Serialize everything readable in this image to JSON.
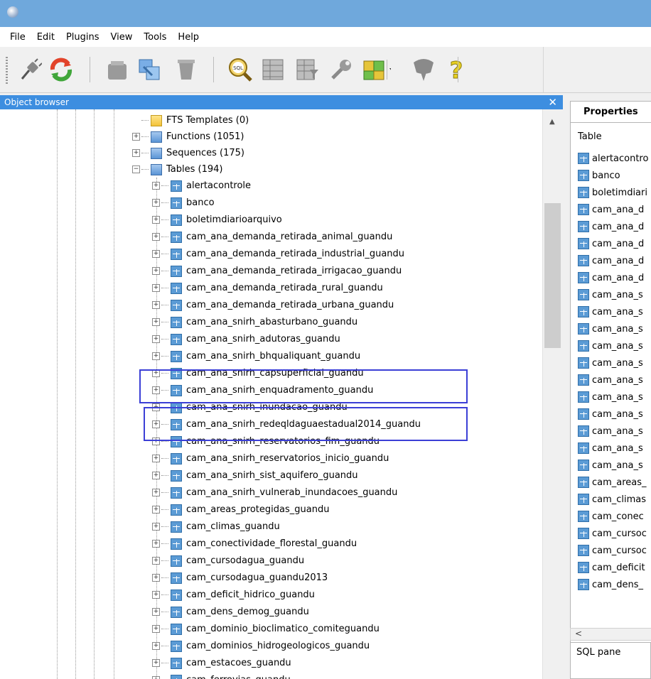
{
  "menu": [
    "File",
    "Edit",
    "Plugins",
    "View",
    "Tools",
    "Help"
  ],
  "toolbar": {
    "icons": [
      "plug-icon",
      "refresh-icon",
      "drop-object-icon",
      "copy-icon",
      "trash-icon",
      "sql-query-icon",
      "view-data-icon",
      "filtered-data-icon",
      "maintenance-wrench-icon",
      "plugins-puzzle-icon",
      "guru-hint-icon",
      "help-icon"
    ],
    "sql_label": "SQL"
  },
  "object_browser": {
    "title": "Object browser",
    "close_glyph": "✕",
    "scroll_up_glyph": "▲",
    "groups": [
      {
        "label": "FTS Templates (0)",
        "icon": "fts-templates-icon",
        "expander": ""
      },
      {
        "label": "Functions (1051)",
        "icon": "functions-icon",
        "expander": "+"
      },
      {
        "label": "Sequences (175)",
        "icon": "sequences-icon",
        "expander": "+"
      },
      {
        "label": "Tables (194)",
        "icon": "tables-folder-icon",
        "expander": "−"
      }
    ],
    "tables": [
      "alertacontrole",
      "banco",
      "boletimdiarioarquivo",
      "cam_ana_demanda_retirada_animal_guandu",
      "cam_ana_demanda_retirada_industrial_guandu",
      "cam_ana_demanda_retirada_irrigacao_guandu",
      "cam_ana_demanda_retirada_rural_guandu",
      "cam_ana_demanda_retirada_urbana_guandu",
      "cam_ana_snirh_abasturbano_guandu",
      "cam_ana_snirh_adutoras_guandu",
      "cam_ana_snirh_bhqualiquant_guandu",
      "cam_ana_snirh_capsuperficial_guandu",
      "cam_ana_snirh_enquadramento_guandu",
      "cam_ana_snirh_inundacao_guandu",
      "cam_ana_snirh_redeqldaguaestadual2014_guandu",
      "cam_ana_snirh_reservatorios_fim_guandu",
      "cam_ana_snirh_reservatorios_inicio_guandu",
      "cam_ana_snirh_sist_aquifero_guandu",
      "cam_ana_snirh_vulnerab_inundacoes_guandu",
      "cam_areas_protegidas_guandu",
      "cam_climas_guandu",
      "cam_conectividade_florestal_guandu",
      "cam_cursodagua_guandu",
      "cam_cursodagua_guandu2013",
      "cam_deficit_hidrico_guandu",
      "cam_dens_demog_guandu",
      "cam_dominio_bioclimatico_comiteguandu",
      "cam_dominios_hidrogeologicos_guandu",
      "cam_estacoes_guandu",
      "cam_ferrovias_guandu"
    ],
    "expander_plus": "+"
  },
  "properties": {
    "tab_label": "Properties",
    "column_header": "Table",
    "rows": [
      "alertacontro",
      "banco",
      "boletimdiari",
      "cam_ana_d",
      "cam_ana_d",
      "cam_ana_d",
      "cam_ana_d",
      "cam_ana_d",
      "cam_ana_s",
      "cam_ana_s",
      "cam_ana_s",
      "cam_ana_s",
      "cam_ana_s",
      "cam_ana_s",
      "cam_ana_s",
      "cam_ana_s",
      "cam_ana_s",
      "cam_ana_s",
      "cam_ana_s",
      "cam_areas_",
      "cam_climas",
      "cam_conec",
      "cam_cursoc",
      "cam_cursoc",
      "cam_deficit",
      "cam_dens_"
    ],
    "scroll_left_glyph": "<"
  },
  "sql_pane": {
    "title": "SQL pane"
  },
  "colors": {
    "titlebar": "#6fa8dc",
    "panel_header": "#3d8ee0",
    "highlight_box": "#3b3fd6"
  }
}
